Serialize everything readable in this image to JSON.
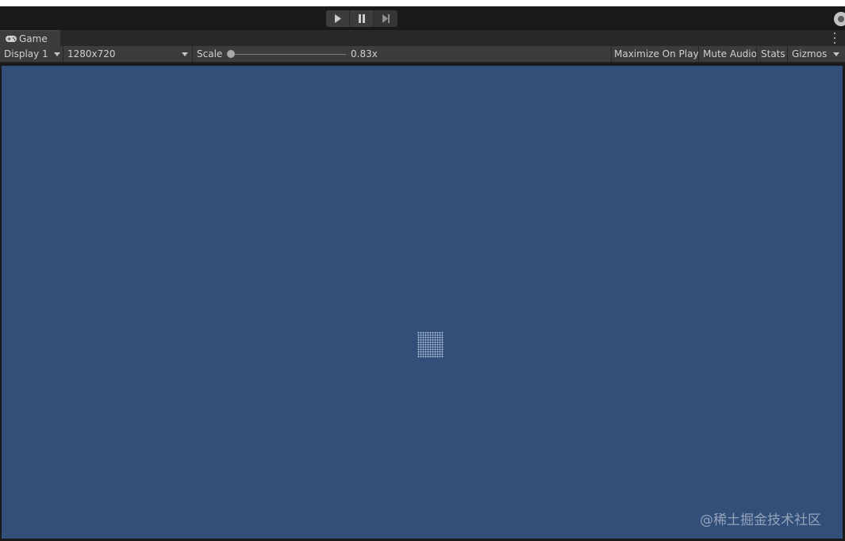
{
  "playbar": {
    "play_icon": "play-icon",
    "pause_icon": "pause-icon",
    "step_icon": "step-icon",
    "account_icon": "account-icon"
  },
  "tab": {
    "icon": "gamepad-icon",
    "label": "Game",
    "menu_icon": "kebab-menu-icon"
  },
  "toolbar": {
    "display": "Display 1",
    "resolution": "1280x720",
    "scale_label": "Scale",
    "scale_value": "0.83x",
    "scale": 0.83,
    "maximize": "Maximize On Play",
    "mute": "Mute Audio",
    "stats": "Stats",
    "gizmos": "Gizmos"
  },
  "view": {
    "background_color": "#324f7a",
    "watermark": "@稀土掘金技术社区"
  }
}
